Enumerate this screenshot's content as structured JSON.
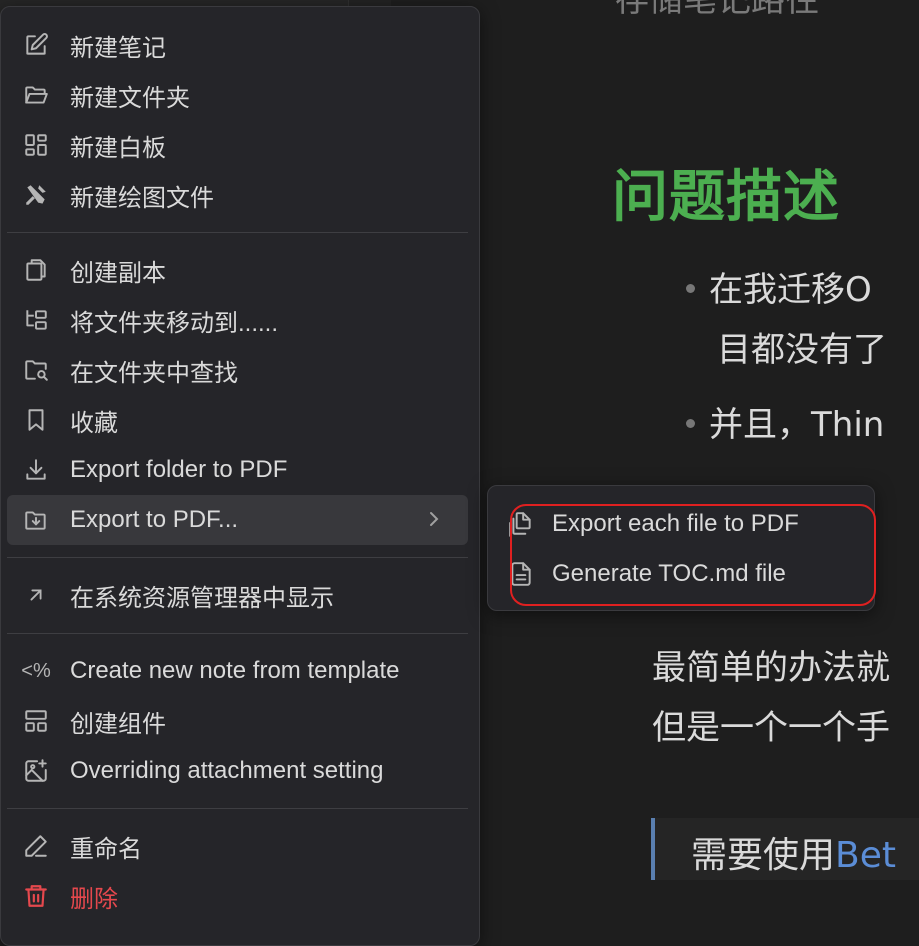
{
  "editor": {
    "top_text": "存储笔记路径",
    "heading": "问题描述",
    "bullets": [
      "在我迁移O",
      "目都没有了",
      "并且，Thin"
    ],
    "para_lines": [
      "最简单的办法就",
      "但是一个一个手"
    ],
    "quote_text": "需要使用",
    "quote_link": "Bet"
  },
  "menu": {
    "items": [
      {
        "label": "新建笔记",
        "icon": "edit-icon"
      },
      {
        "label": "新建文件夹",
        "icon": "folder-open-icon"
      },
      {
        "label": "新建白板",
        "icon": "layout-dashboard-icon"
      },
      {
        "label": "新建绘图文件",
        "icon": "excalidraw-icon"
      },
      {
        "label": "创建副本",
        "icon": "copy-icon"
      },
      {
        "label": "将文件夹移动到......",
        "icon": "folder-tree-icon"
      },
      {
        "label": "在文件夹中查找",
        "icon": "folder-search-icon"
      },
      {
        "label": "收藏",
        "icon": "bookmark-icon"
      },
      {
        "label": "Export folder to PDF",
        "icon": "download-icon"
      },
      {
        "label": "Export to PDF...",
        "icon": "folder-down-icon"
      },
      {
        "label": "在系统资源管理器中显示",
        "icon": "arrow-up-right-icon"
      },
      {
        "label": "Create new note from template",
        "icon": "template-icon"
      },
      {
        "label": "创建组件",
        "icon": "layout-grid-icon"
      },
      {
        "label": "Overriding attachment setting",
        "icon": "image-plus-icon"
      },
      {
        "label": "重命名",
        "icon": "pencil-icon"
      },
      {
        "label": "删除",
        "icon": "trash-icon"
      }
    ]
  },
  "submenu": {
    "items": [
      {
        "label": "Export each file to PDF",
        "icon": "files-icon"
      },
      {
        "label": "Generate TOC.md file",
        "icon": "file-text-icon"
      }
    ]
  },
  "colors": {
    "accent_heading": "#4caf50",
    "danger": "#e5484d",
    "highlight_box": "#e02020",
    "link": "#5b8dd6"
  }
}
